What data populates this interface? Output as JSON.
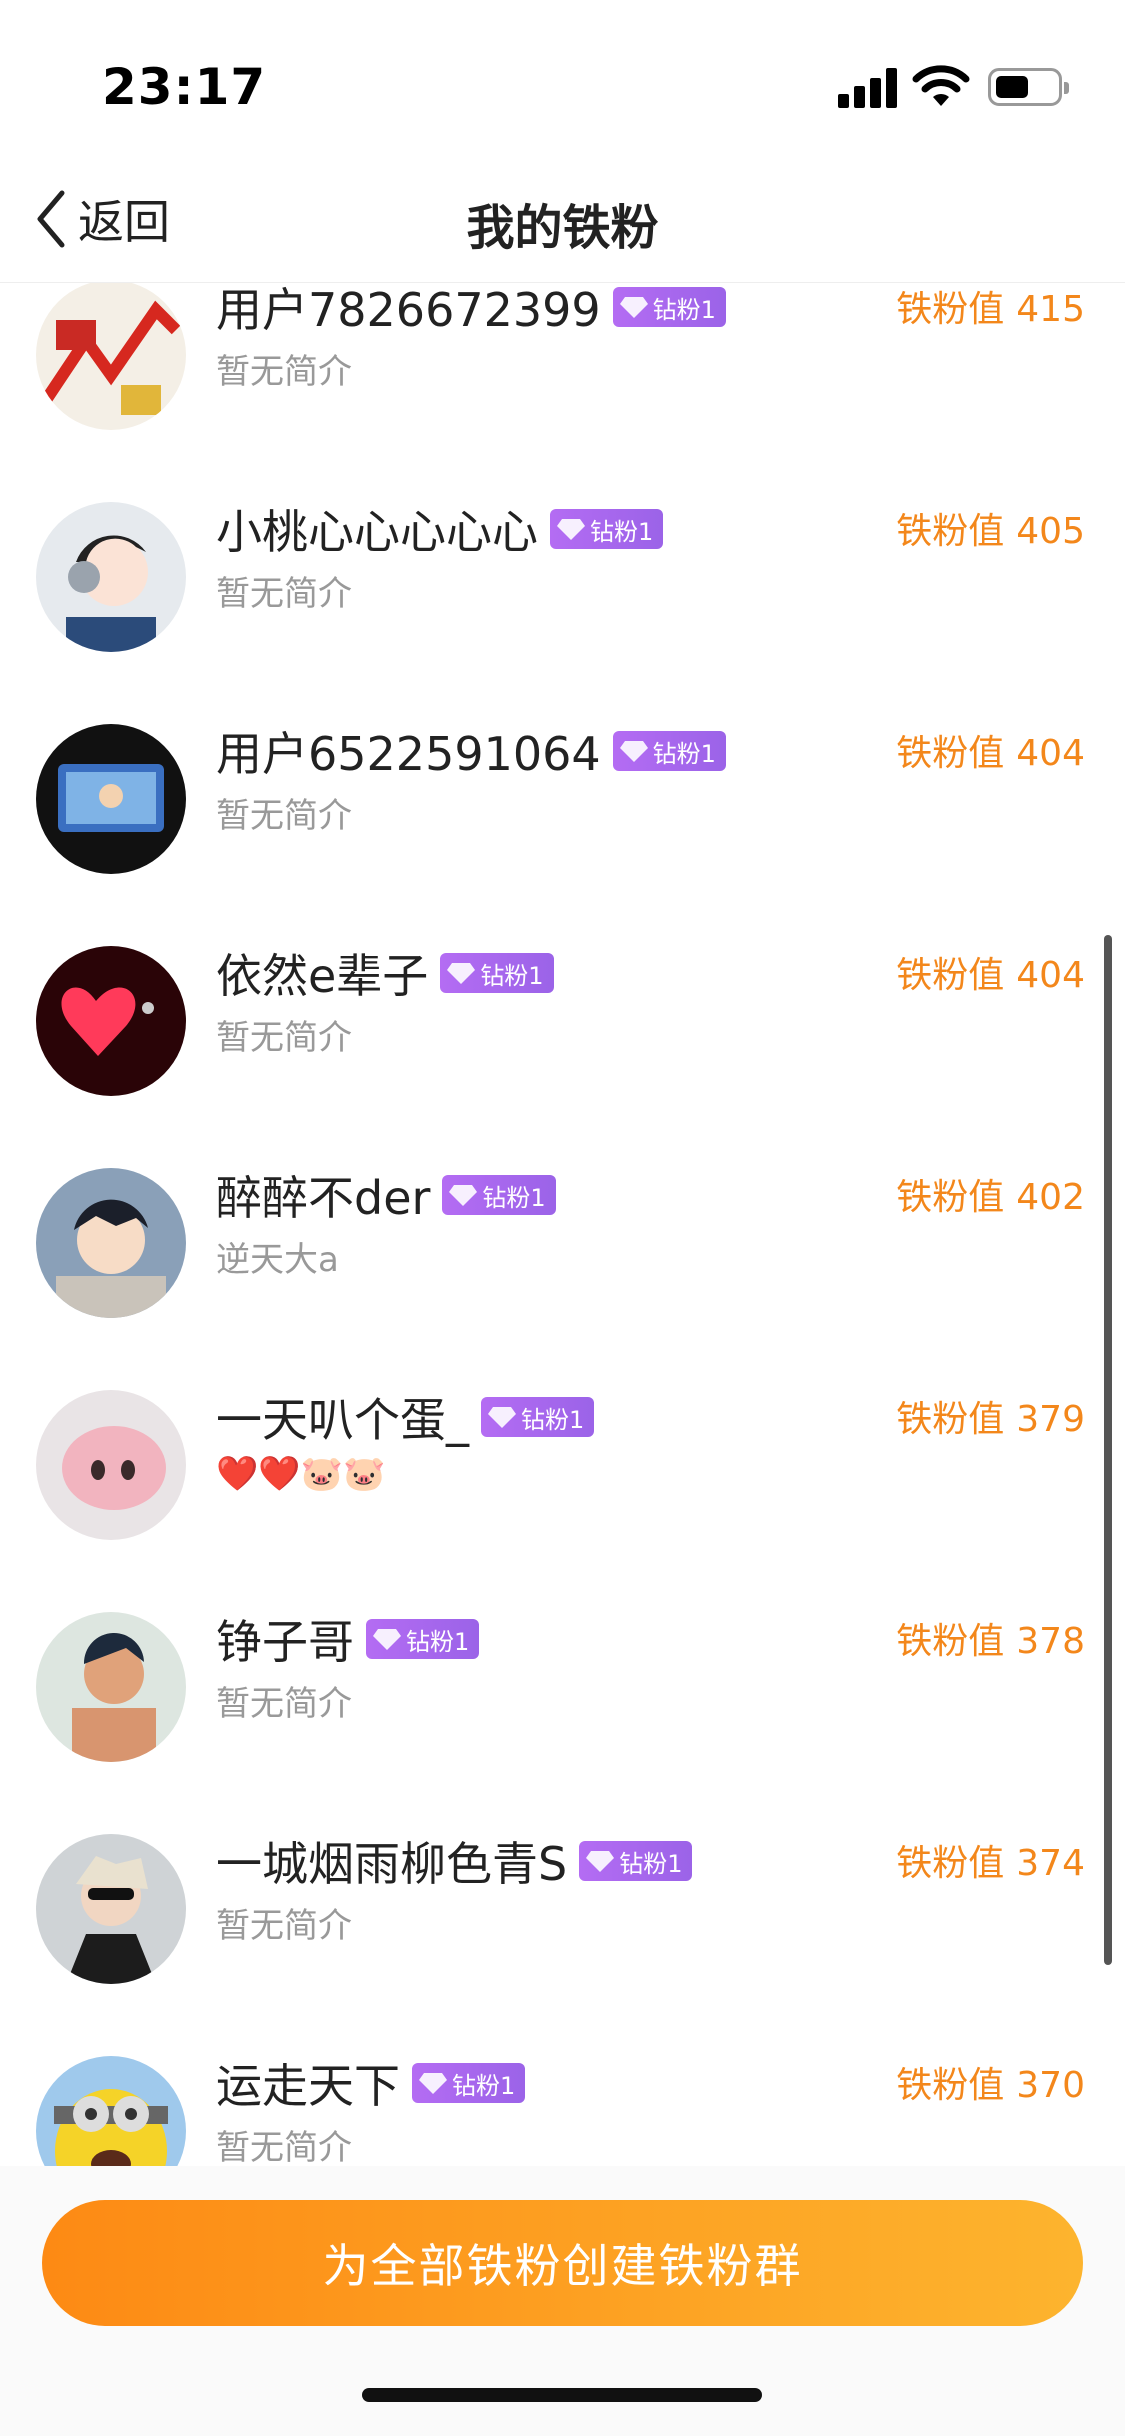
{
  "status_bar": {
    "time": "23:17"
  },
  "nav": {
    "back_label": "返回",
    "title": "我的铁粉"
  },
  "score_label": "铁粉值",
  "fans": [
    {
      "name": "用户7826672399",
      "badge": "钻粉1",
      "bio": "暂无简介",
      "score": "415"
    },
    {
      "name": "小桃心心心心心",
      "badge": "钻粉1",
      "bio": "暂无简介",
      "score": "405"
    },
    {
      "name": "用户6522591064",
      "badge": "钻粉1",
      "bio": "暂无简介",
      "score": "404"
    },
    {
      "name": "依然e辈子",
      "badge": "钻粉1",
      "bio": "暂无简介",
      "score": "404"
    },
    {
      "name": "醉醉不der",
      "badge": "钻粉1",
      "bio": "逆天大a",
      "score": "402"
    },
    {
      "name": "一天叭个蛋_",
      "badge": "钻粉1",
      "bio": "❤️❤️🐷🐷",
      "score": "379"
    },
    {
      "name": "铮子哥",
      "badge": "钻粉1",
      "bio": "暂无简介",
      "score": "378"
    },
    {
      "name": "一城烟雨柳色青S",
      "badge": "钻粉1",
      "bio": "暂无简介",
      "score": "374"
    },
    {
      "name": "运走天下",
      "badge": "钻粉1",
      "bio": "暂无简介",
      "score": "370"
    }
  ],
  "bottom": {
    "create_group_label": "为全部铁粉创建铁粉群"
  },
  "colors": {
    "accent": "#f3871b",
    "badge": "#a866ee",
    "button_start": "#fd8a14",
    "button_end": "#fdb42e"
  }
}
